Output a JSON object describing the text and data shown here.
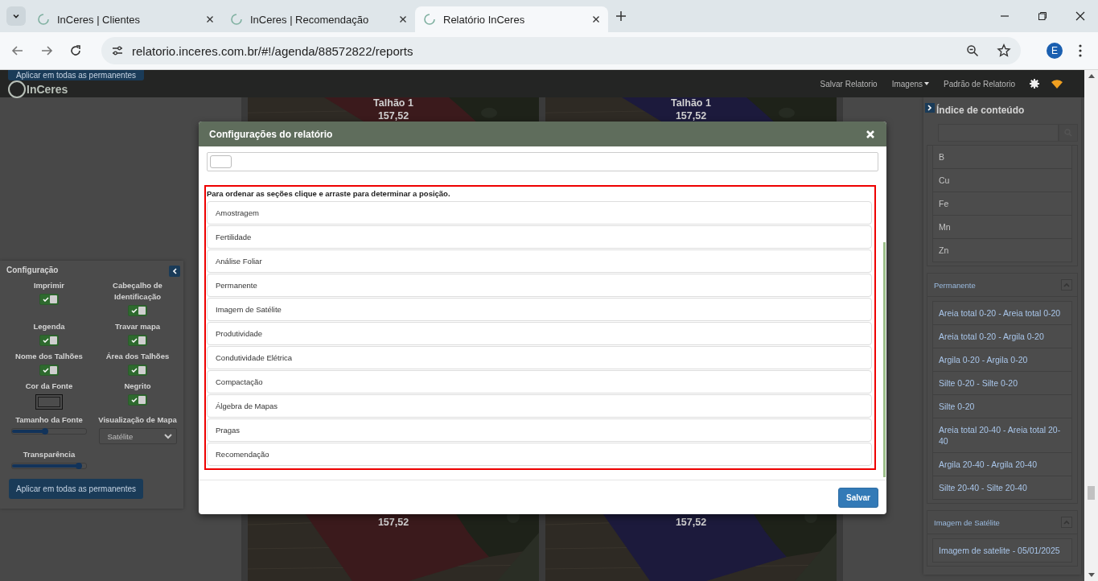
{
  "browser": {
    "tabs": [
      {
        "title": "InCeres | Clientes",
        "selected": false
      },
      {
        "title": "InCeres | Recomendação",
        "selected": false
      },
      {
        "title": "Relatório InCeres",
        "selected": true
      }
    ],
    "url": "relatorio.inceres.com.br/#!/agenda/88572822/reports",
    "profile_initial": "E"
  },
  "app": {
    "logo": "InCeres",
    "floating_button": "Aplicar em todas as permanentes",
    "nav_items": [
      {
        "label": "Salvar Relatorio",
        "kind": "link"
      },
      {
        "label": "Imagens",
        "kind": "dropdown"
      },
      {
        "label": "Padrão de Relatorio",
        "kind": "link"
      }
    ]
  },
  "maps": {
    "top": [
      {
        "label": "Talhão 1",
        "area": "157,52",
        "color": "#3b1a1c"
      },
      {
        "label": "Talhão 1",
        "area": "157,52",
        "color": "#1c1a3c"
      }
    ],
    "bottom": [
      {
        "area": "157,52",
        "color": "#3b1a1c"
      },
      {
        "area": "157,52",
        "color": "#1c1a3c"
      }
    ]
  },
  "config": {
    "title": "Configuração",
    "controls": [
      {
        "label": "Imprimir",
        "kind": "toggle",
        "checked": true
      },
      {
        "label": "Cabeçalho de Identificação",
        "kind": "toggle",
        "checked": true
      },
      {
        "label": "Legenda",
        "kind": "toggle",
        "checked": true
      },
      {
        "label": "Travar mapa",
        "kind": "toggle",
        "checked": true
      },
      {
        "label": "Nome dos Talhões",
        "kind": "toggle",
        "checked": true
      },
      {
        "label": "Área dos Talhões",
        "kind": "toggle",
        "checked": true
      },
      {
        "label": "Cor da Fonte",
        "kind": "color"
      },
      {
        "label": "Negrito",
        "kind": "toggle",
        "checked": true
      },
      {
        "label": "Tamanho da Fonte",
        "kind": "slider",
        "level": 0.45
      },
      {
        "label": "Visualização de Mapa",
        "kind": "select",
        "value": "Satélite"
      },
      {
        "label": "Transparência",
        "kind": "slider",
        "level": 0.9
      }
    ],
    "button": "Aplicar em todas as permanentes"
  },
  "index": {
    "title": "Índice de conteúdo",
    "groups": [
      {
        "items": [
          "B",
          "Cu",
          "Fe",
          "Mn",
          "Zn"
        ]
      },
      {
        "title": "Permanente",
        "expanded": true,
        "items": [
          "Areia total 0-20 - Areia total 0-20",
          "Areia total 0-20 - Argila 0-20",
          "Argila 0-20 - Argila 0-20",
          "Silte 0-20 - Silte 0-20",
          "Silte 0-20",
          "Areia total 20-40 - Areia total 20-40",
          "Argila 20-40 - Argila 20-40",
          "Silte 20-40 - Silte 20-40"
        ]
      },
      {
        "title": "Imagem de Satélite",
        "expanded": true,
        "items": [
          "Imagem de satelite - 05/01/2025"
        ]
      }
    ]
  },
  "modal": {
    "title": "Configurações do relatório",
    "instruction": "Para ordenar as seções clique e arraste para determinar a posição.",
    "sections": [
      "Amostragem",
      "Fertilidade",
      "Análise Foliar",
      "Permanente",
      "Imagem de Satélite",
      "Produtividade",
      "Condutividade Elétrica",
      "Compactação",
      "Álgebra de Mapas",
      "Pragas",
      "Recomendação"
    ],
    "save_button": "Salvar"
  }
}
